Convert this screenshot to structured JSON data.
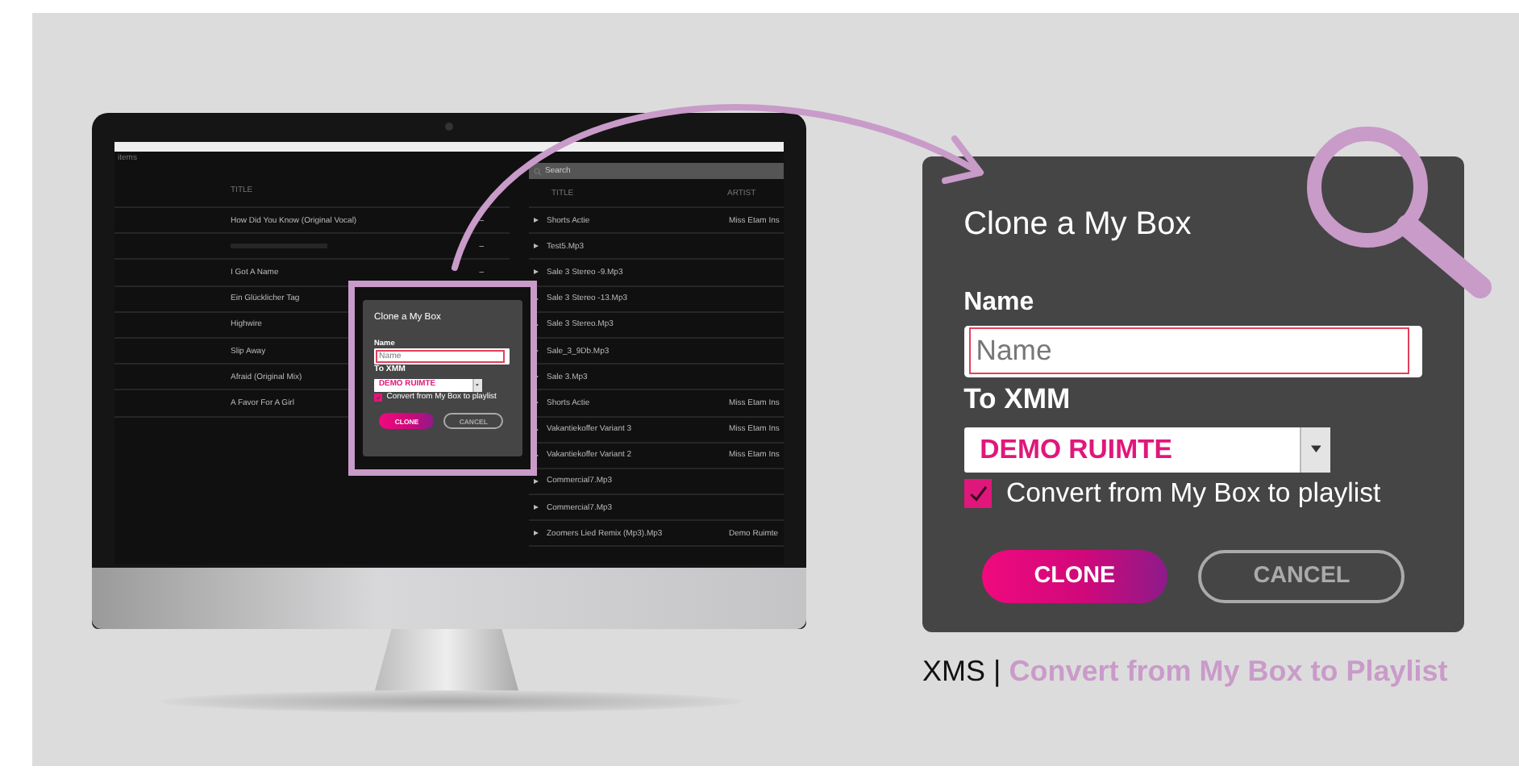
{
  "screen": {
    "top_label": "items",
    "left_table": {
      "columns": [
        "TITLE"
      ],
      "rows": [
        {
          "title": "How Did You Know (Original Vocal)",
          "mark": "–"
        },
        {
          "mark": "–"
        },
        {
          "title": "I Got A Name",
          "mark": "–"
        },
        {
          "title": "Ein Glücklicher Tag"
        },
        {
          "title": "Highwire"
        },
        {
          "title": "Slip Away"
        },
        {
          "title": "Afraid (Original Mix)"
        },
        {
          "title": "A Favor For A Girl"
        }
      ]
    },
    "search": {
      "placeholder": "Search"
    },
    "right_table": {
      "columns": [
        "TITLE",
        "ARTIST"
      ],
      "rows": [
        {
          "title": "Shorts Actie",
          "artist": "Miss Etam Ins"
        },
        {
          "title": "Test5.Mp3"
        },
        {
          "title": "Sale 3 Stereo -9.Mp3"
        },
        {
          "title": "Sale 3 Stereo -13.Mp3"
        },
        {
          "title": "Sale 3 Stereo.Mp3"
        },
        {
          "title": "Sale_3_9Db.Mp3"
        },
        {
          "title": "Sale 3.Mp3"
        },
        {
          "title": "Shorts Actie",
          "artist": "Miss Etam Ins"
        },
        {
          "title": "Vakantiekoffer Variant 3",
          "artist": "Miss Etam Ins"
        },
        {
          "title": "Vakantiekoffer Variant 2",
          "artist": "Miss Etam Ins"
        },
        {
          "title": "Commercial7.Mp3"
        },
        {
          "title": "Commercial7.Mp3"
        },
        {
          "title": "Zoomers Lied Remix (Mp3).Mp3",
          "artist": "Demo Ruimte"
        }
      ]
    },
    "dialog": {
      "title": "Clone a My Box",
      "name_label": "Name",
      "name_field": {
        "placeholder": "Name"
      },
      "target_label": "To XMM",
      "target_select": {
        "value": "DEMO RUIMTE"
      },
      "convert": {
        "label": "Convert from My Box to playlist",
        "checked": true
      },
      "buttons": [
        {
          "label": "CLONE",
          "kind": "primary"
        },
        {
          "label": "CANCEL",
          "kind": "secondary"
        }
      ]
    }
  },
  "dialog": {
    "title": "Clone a My Box",
    "name_label": "Name",
    "name_field": {
      "placeholder": "Name"
    },
    "target_label": "To XMM",
    "target_select": {
      "value": "DEMO RUIMTE"
    },
    "convert": {
      "label": "Convert from My Box to playlist",
      "checked": true
    },
    "buttons": [
      {
        "label": "CLONE",
        "kind": "primary"
      },
      {
        "label": "CANCEL",
        "kind": "secondary"
      }
    ]
  },
  "caption": {
    "brand": "XMS",
    "separator": "|",
    "text": "Convert from My Box to Playlist"
  }
}
